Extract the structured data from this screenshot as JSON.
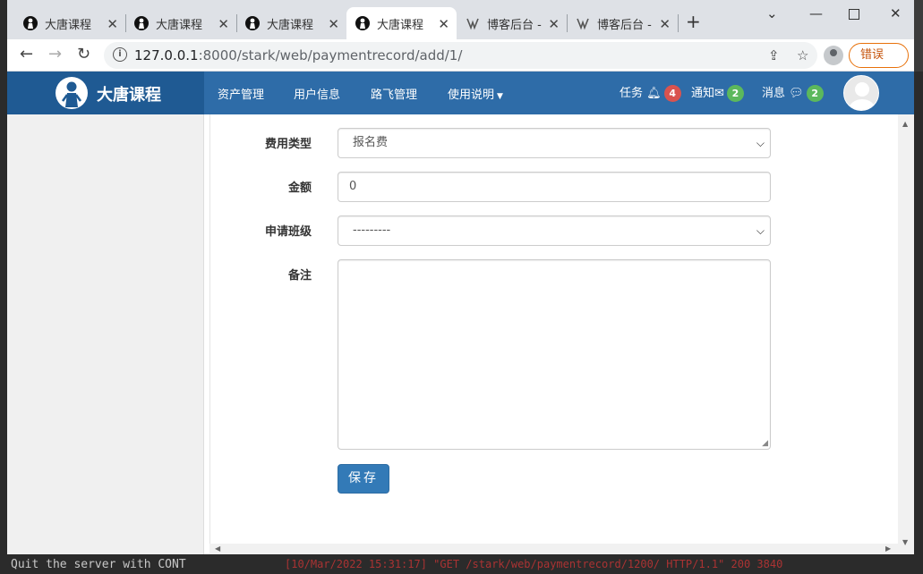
{
  "browser": {
    "tabs": [
      {
        "title": "大唐课程",
        "icon": "person-logo-icon"
      },
      {
        "title": "大唐课程",
        "icon": "person-logo-icon"
      },
      {
        "title": "大唐课程",
        "icon": "person-logo-icon"
      },
      {
        "title": "大唐课程",
        "icon": "person-logo-icon",
        "active": true
      },
      {
        "title": "博客后台 -",
        "icon": "blog-logo-icon"
      },
      {
        "title": "博客后台 -",
        "icon": "blog-logo-icon"
      }
    ],
    "url_host": "127.0.0.1",
    "url_path": ":8000/stark/web/paymentrecord/add/1/",
    "error_button": "错误"
  },
  "app": {
    "brand": "大唐课程",
    "nav": [
      "资产管理",
      "用户信息",
      "路飞管理",
      "使用说明"
    ],
    "right": [
      {
        "label": "任务",
        "icon": "bell-icon",
        "count": "4",
        "color": "#d9534f"
      },
      {
        "label": "通知",
        "icon": "envelope-icon",
        "count": "2",
        "color": "#5cb85c"
      },
      {
        "label": "消息",
        "icon": "comment-icon",
        "count": "2",
        "color": "#5cb85c"
      }
    ]
  },
  "form": {
    "fee_type_label": "费用类型",
    "fee_type_value": "报名费",
    "amount_label": "金额",
    "amount_value": "0",
    "class_label": "申请班级",
    "class_value": "---------",
    "note_label": "备注",
    "note_value": "",
    "save_label": "保存"
  },
  "terminal": {
    "bottom_line": "Quit the server with CONT",
    "bottom_log": "[10/Mar/2022 15:31:17] \"GET /stark/web/paymentrecord/1200/ HTTP/1.1\" 200 3840"
  }
}
